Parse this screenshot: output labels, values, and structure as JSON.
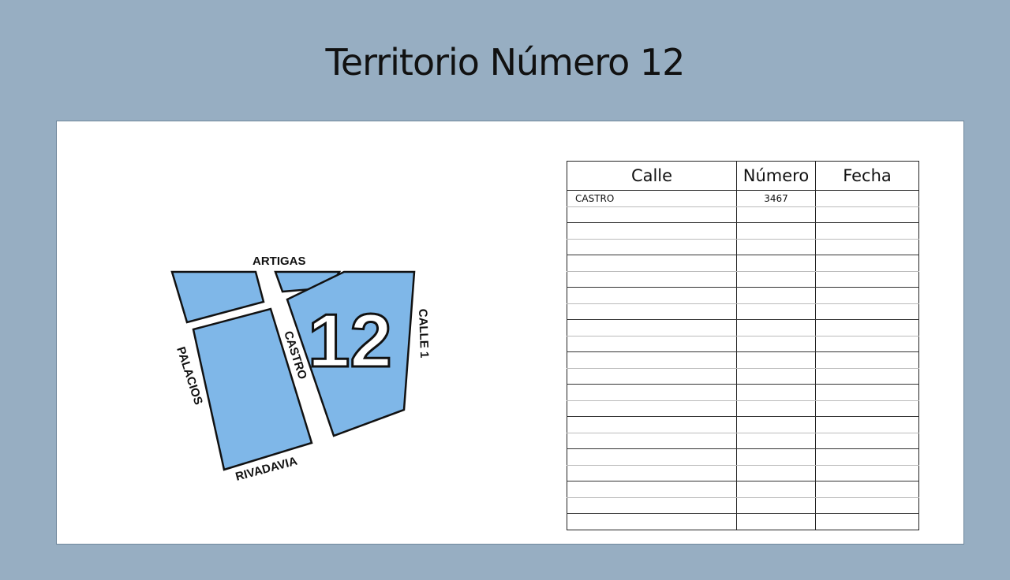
{
  "title": "Territorio Número 12",
  "map": {
    "territory_number": "12",
    "streets": [
      "ARTIGAS",
      "CASTRO",
      "PALACIOS",
      "RIVADAVIA",
      "CALLE 1"
    ],
    "block_color": "#7fb7e8"
  },
  "table": {
    "headers": [
      "Calle",
      "Número",
      "Fecha"
    ],
    "rows": [
      [
        "CASTRO",
        "3467",
        ""
      ],
      [
        "",
        "",
        ""
      ],
      [
        "",
        "",
        ""
      ],
      [
        "",
        "",
        ""
      ],
      [
        "",
        "",
        ""
      ],
      [
        "",
        "",
        ""
      ],
      [
        "",
        "",
        ""
      ],
      [
        "",
        "",
        ""
      ],
      [
        "",
        "",
        ""
      ],
      [
        "",
        "",
        ""
      ],
      [
        "",
        "",
        ""
      ],
      [
        "",
        "",
        ""
      ],
      [
        "",
        "",
        ""
      ],
      [
        "",
        "",
        ""
      ],
      [
        "",
        "",
        ""
      ],
      [
        "",
        "",
        ""
      ],
      [
        "",
        "",
        ""
      ],
      [
        "",
        "",
        ""
      ],
      [
        "",
        "",
        ""
      ],
      [
        "",
        "",
        ""
      ],
      [
        "",
        "",
        ""
      ]
    ]
  },
  "colors": {
    "background": "#97aec2",
    "panel": "#ffffff"
  }
}
